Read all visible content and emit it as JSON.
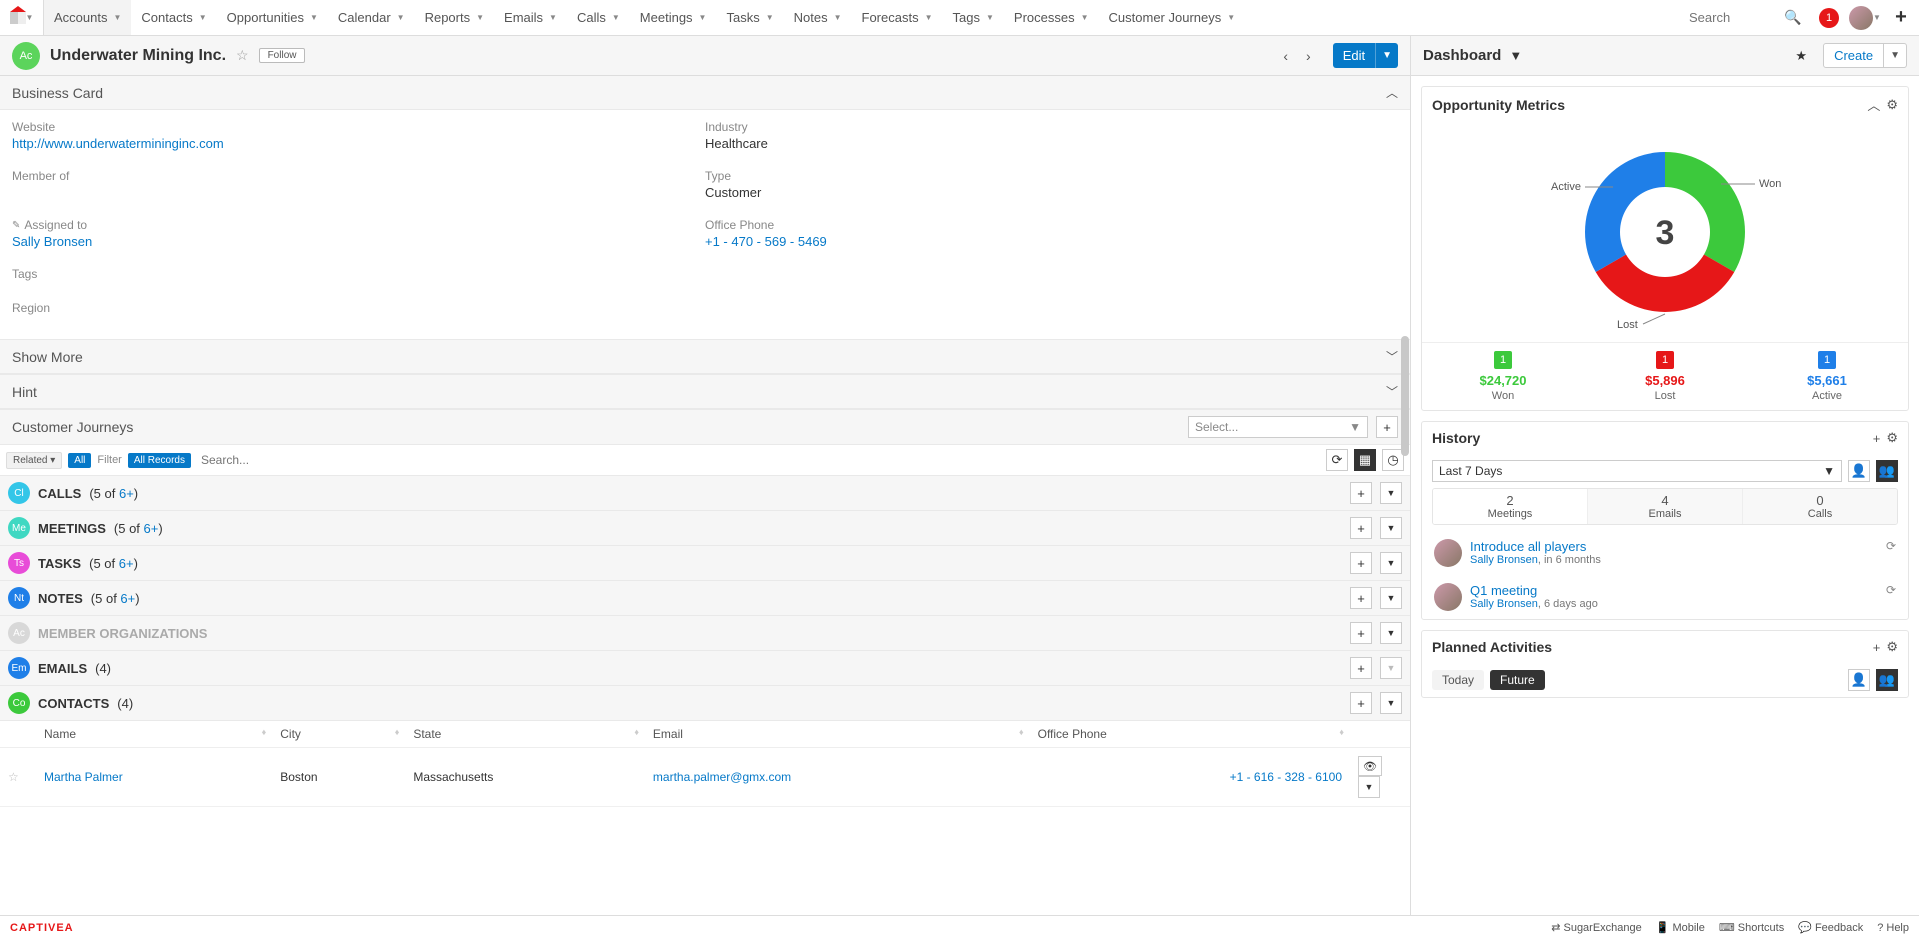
{
  "nav": {
    "items": [
      "Accounts",
      "Contacts",
      "Opportunities",
      "Calendar",
      "Reports",
      "Emails",
      "Calls",
      "Meetings",
      "Tasks",
      "Notes",
      "Forecasts",
      "Tags",
      "Processes",
      "Customer Journeys"
    ],
    "active": 0,
    "search_placeholder": "Search",
    "notif_count": "1"
  },
  "record": {
    "badge": "Ac",
    "title": "Underwater Mining Inc.",
    "follow": "Follow",
    "edit": "Edit"
  },
  "sections": {
    "business_card": "Business Card",
    "show_more": "Show More",
    "hint": "Hint",
    "customer_journeys": "Customer Journeys"
  },
  "fields": {
    "website": {
      "label": "Website",
      "value": "http://www.underwatermininginc.com",
      "link": true
    },
    "industry": {
      "label": "Industry",
      "value": "Healthcare"
    },
    "member_of": {
      "label": "Member of",
      "value": ""
    },
    "type": {
      "label": "Type",
      "value": "Customer"
    },
    "assigned_to": {
      "label": "Assigned to",
      "value": "Sally Bronsen",
      "link": true,
      "edit": true
    },
    "office_phone": {
      "label": "Office Phone",
      "value": "+1 - 470 - 569 - 5469",
      "link": true
    },
    "tags": {
      "label": "Tags",
      "value": ""
    },
    "region": {
      "label": "Region",
      "value": ""
    }
  },
  "cj": {
    "select_placeholder": "Select..."
  },
  "filter": {
    "related": "Related",
    "all": "All",
    "filter_label": "Filter",
    "all_records": "All Records",
    "search_placeholder": "Search..."
  },
  "panels": [
    {
      "ico": "Cl",
      "color": "#33c6e8",
      "title": "CALLS",
      "count_a": "5",
      "count_b": "6+",
      "enabled": true,
      "drop": true
    },
    {
      "ico": "Me",
      "color": "#3fd8c2",
      "title": "MEETINGS",
      "count_a": "5",
      "count_b": "6+",
      "enabled": true,
      "drop": true
    },
    {
      "ico": "Ts",
      "color": "#e84cd8",
      "title": "TASKS",
      "count_a": "5",
      "count_b": "6+",
      "enabled": true,
      "drop": true
    },
    {
      "ico": "Nt",
      "color": "#1f7fe8",
      "title": "NOTES",
      "count_a": "5",
      "count_b": "6+",
      "enabled": true,
      "drop": true
    },
    {
      "ico": "Ac",
      "color": "#d8d8d8",
      "title": "MEMBER ORGANIZATIONS",
      "count_a": "",
      "count_b": "",
      "enabled": false,
      "drop": true
    },
    {
      "ico": "Em",
      "color": "#1f7fe8",
      "title": "EMAILS",
      "count_a": "4",
      "count_b": "",
      "enabled": true,
      "drop": false
    },
    {
      "ico": "Co",
      "color": "#3cc93c",
      "title": "CONTACTS",
      "count_a": "4",
      "count_b": "",
      "enabled": true,
      "drop": true
    }
  ],
  "contacts": {
    "headers": [
      "Name",
      "City",
      "State",
      "Email",
      "Office Phone"
    ],
    "rows": [
      {
        "name": "Martha Palmer",
        "city": "Boston",
        "state": "Massachusetts",
        "email": "martha.palmer@gmx.com",
        "phone": "+1 - 616 - 328 - 6100"
      }
    ]
  },
  "dashboard": {
    "title": "Dashboard",
    "create": "Create"
  },
  "opp_metrics": {
    "title": "Opportunity Metrics",
    "center": "3",
    "legend": {
      "active": "Active",
      "won": "Won",
      "lost": "Lost"
    },
    "stats": [
      {
        "badge": "1",
        "color": "#3cc93c",
        "amount": "$24,720",
        "label": "Won"
      },
      {
        "badge": "1",
        "color": "#e61718",
        "amount": "$5,896",
        "label": "Lost"
      },
      {
        "badge": "1",
        "color": "#1f7fe8",
        "amount": "$5,661",
        "label": "Active"
      }
    ]
  },
  "chart_data": {
    "type": "pie",
    "variant": "donut",
    "title": "Opportunity Metrics",
    "center_label": "3",
    "series": [
      {
        "name": "Won",
        "value": 1,
        "amount_usd": 24720,
        "color": "#3cc93c"
      },
      {
        "name": "Lost",
        "value": 1,
        "amount_usd": 5896,
        "color": "#e61718"
      },
      {
        "name": "Active",
        "value": 1,
        "amount_usd": 5661,
        "color": "#1f7fe8"
      }
    ]
  },
  "history": {
    "title": "History",
    "range": "Last 7 Days",
    "tabs": [
      {
        "n": "2",
        "label": "Meetings"
      },
      {
        "n": "4",
        "label": "Emails"
      },
      {
        "n": "0",
        "label": "Calls"
      }
    ],
    "items": [
      {
        "title": "Introduce all players",
        "user": "Sally Bronsen",
        "when": ", in 6 months"
      },
      {
        "title": "Q1 meeting",
        "user": "Sally Bronsen",
        "when": ", 6 days ago"
      }
    ]
  },
  "planned": {
    "title": "Planned Activities",
    "today": "Today",
    "future": "Future"
  },
  "footer": {
    "brand": "CAPTIVEA",
    "items": [
      "SugarExchange",
      "Mobile",
      "Shortcuts",
      "Feedback",
      "Help"
    ]
  }
}
